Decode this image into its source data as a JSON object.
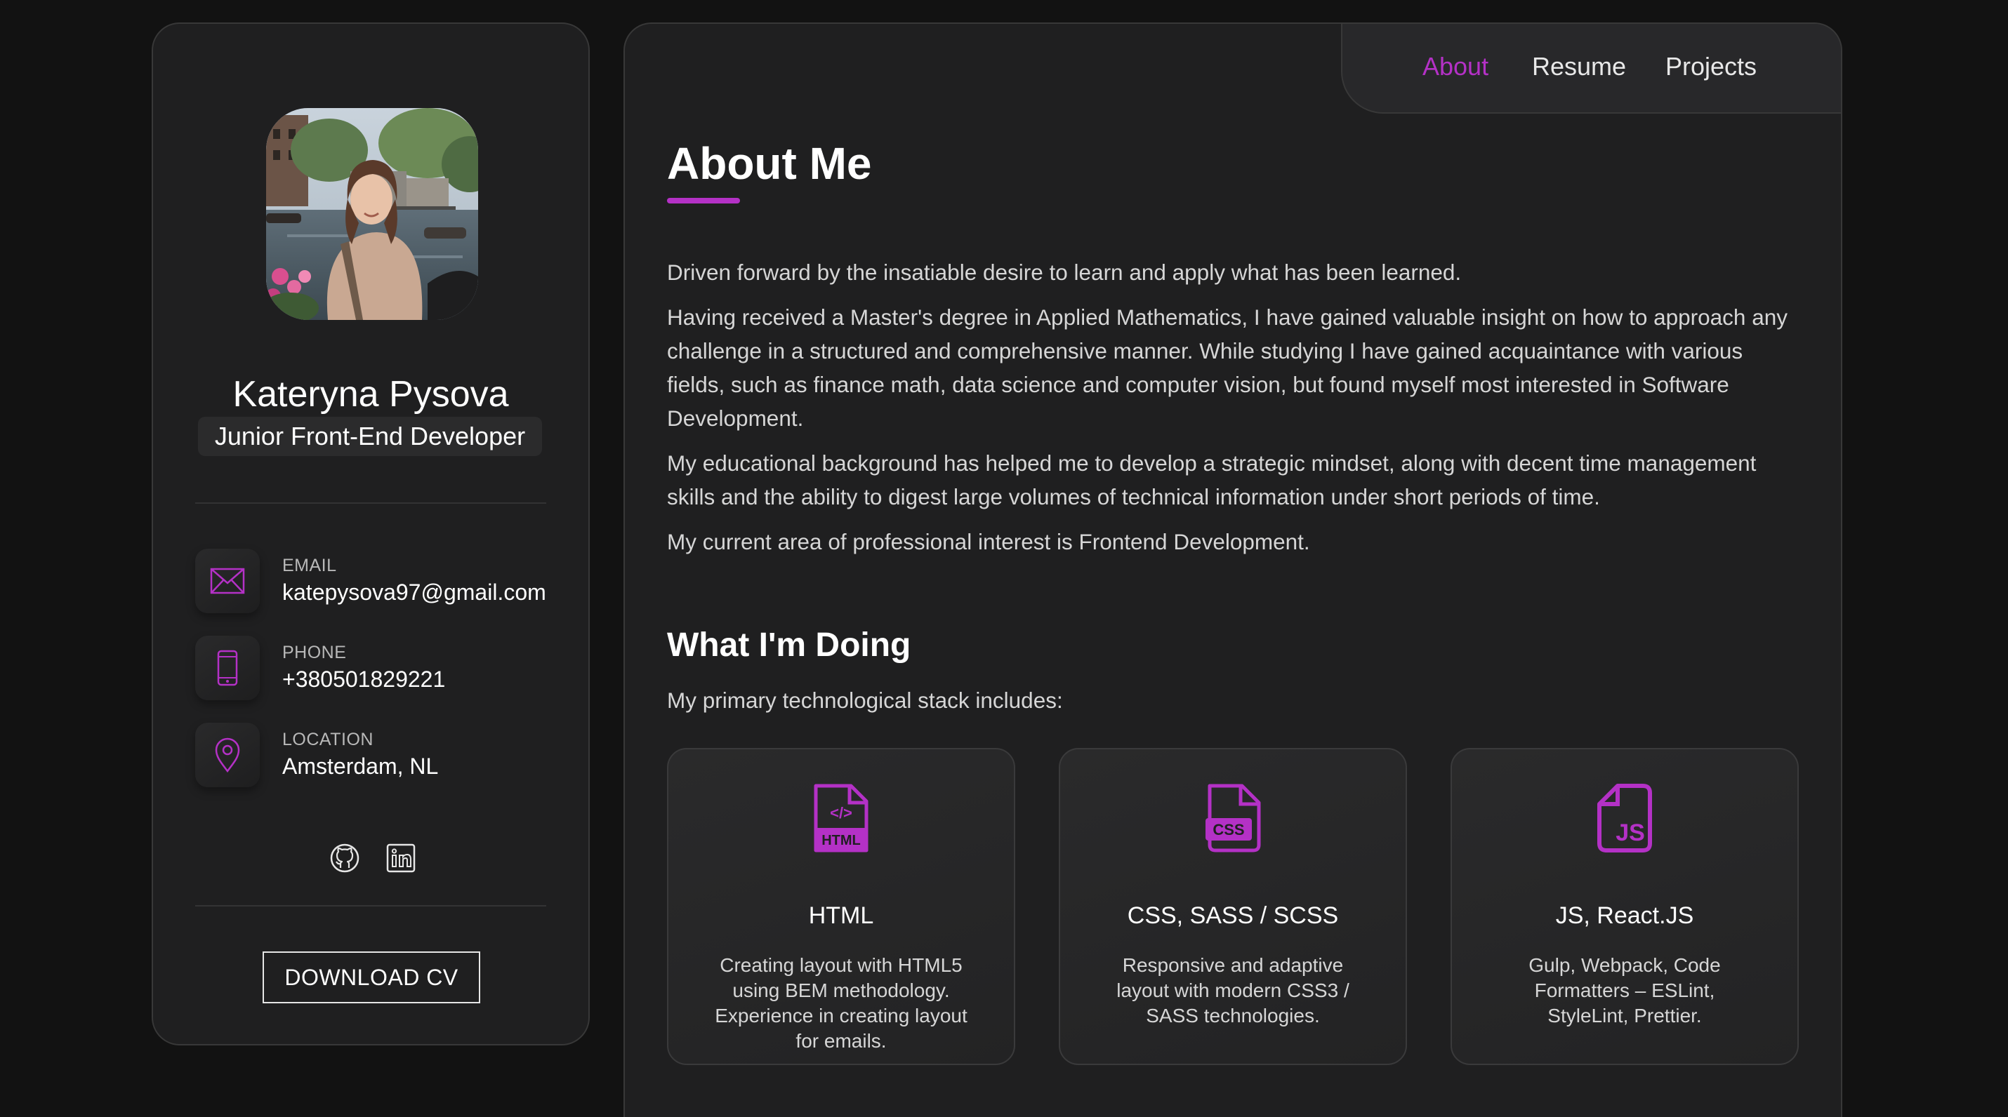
{
  "colors": {
    "accent": "#b431c6",
    "background": "#121212",
    "panel": "#1f1f20"
  },
  "profile": {
    "name": "Kateryna Pysova",
    "title": "Junior Front-End Developer"
  },
  "contacts": [
    {
      "icon": "mail-icon",
      "label": "EMAIL",
      "value": "katepysova97@gmail.com"
    },
    {
      "icon": "phone-icon",
      "label": "PHONE",
      "value": "+380501829221"
    },
    {
      "icon": "location-pin-icon",
      "label": "LOCATION",
      "value": "Amsterdam, NL"
    }
  ],
  "socials": [
    {
      "icon": "github-icon"
    },
    {
      "icon": "linkedin-icon"
    }
  ],
  "download_label": "DOWNLOAD CV",
  "nav": {
    "items": [
      {
        "label": "About",
        "active": true
      },
      {
        "label": "Resume",
        "active": false
      },
      {
        "label": "Projects",
        "active": false
      }
    ]
  },
  "about": {
    "heading": "About Me",
    "paragraphs": [
      "Driven forward by the insatiable desire to learn and apply what has been learned.",
      "Having received a Master's degree in Applied Mathematics, I have gained valuable insight on how to approach any challenge in a structured and comprehensive manner. While studying I have gained acquaintance with various fields, such as finance math, data science and computer vision, but found myself most interested in Software Development.",
      "My educational background has helped me to develop a strategic mindset, along with decent time management skills and the ability to digest large volumes of technical information under short periods of time.",
      "My current area of professional interest is Frontend Development."
    ]
  },
  "doing": {
    "heading": "What I'm Doing",
    "intro": "My primary technological stack includes:",
    "cards": [
      {
        "icon": "html-file-icon",
        "title": "HTML",
        "text": "Creating layout with HTML5 using BEM methodology. Experience in creating layout for emails."
      },
      {
        "icon": "css-file-icon",
        "title": "CSS, SASS / SCSS",
        "text": "Responsive and adaptive layout with modern CSS3 / SASS technologies."
      },
      {
        "icon": "js-file-icon",
        "title": "JS, React.JS",
        "text": "Gulp, Webpack, Code Formatters – ESLint, StyleLint, Prettier."
      }
    ]
  }
}
